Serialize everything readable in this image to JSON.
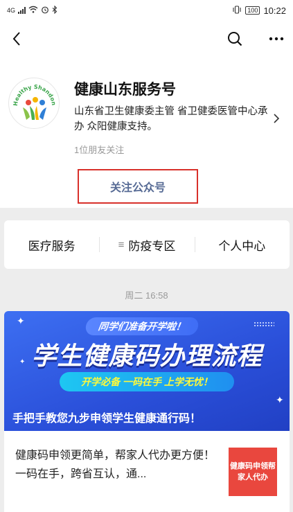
{
  "status_bar": {
    "signal_label": "4G",
    "battery": "100",
    "time": "10:22"
  },
  "navbar": {
    "back_icon": "back-icon",
    "search_icon": "search-icon",
    "more_icon": "more-icon"
  },
  "account": {
    "name": "健康山东服务号",
    "description": "山东省卫生健康委主管 省卫健委医管中心承办    众阳健康支持。",
    "followers": "1位朋友关注",
    "follow_button": "关注公众号",
    "logo_text": "Healthy Shandong"
  },
  "menu": {
    "items": [
      {
        "label": "医疗服务",
        "icon": ""
      },
      {
        "label": "防疫专区",
        "icon": "≡"
      },
      {
        "label": "个人中心",
        "icon": ""
      }
    ]
  },
  "feed": {
    "timestamp": "周二 16:58",
    "article": {
      "banner_tag": "同学们准备开学啦！",
      "banner_title": "学生健康码办理流程",
      "banner_pill": "开学必备  一码在手  上学无忧！",
      "title": "手把手教您九步申领学生健康通行码！",
      "summary": "健康码申领更简单，帮家人代办更方便！ 一码在手，跨省互认，通...",
      "thumb_text": "健康码申领帮家人代办"
    }
  },
  "colors": {
    "accent_link": "#576b95",
    "highlight_box": "#d8302a",
    "banner_blue": "#2a4fd9"
  }
}
